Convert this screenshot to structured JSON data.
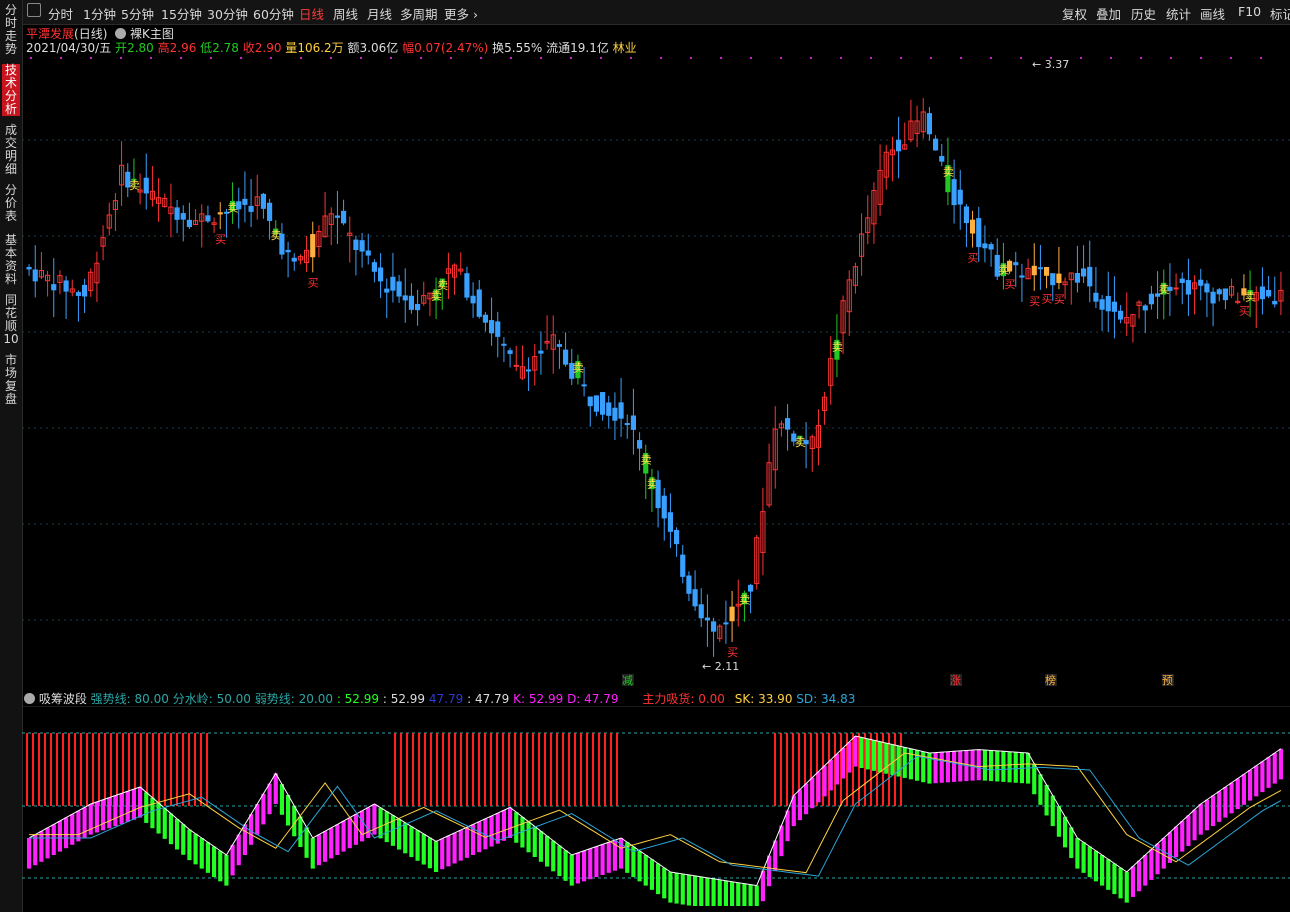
{
  "toolbar": {
    "periods": [
      "分时",
      "1分钟",
      "5分钟",
      "15分钟",
      "30分钟",
      "60分钟",
      "日线",
      "周线",
      "月线",
      "多周期",
      "更多"
    ],
    "active": "日线",
    "right": [
      "复权",
      "叠加",
      "历史",
      "统计",
      "画线",
      "F10",
      "标记"
    ]
  },
  "sidebar": [
    "分时走势",
    "技术分析",
    "成交明细",
    "分价表",
    "基本资料",
    "同花顺10",
    "市场复盘"
  ],
  "stock": {
    "name": "平潭发展",
    "period": "(日线)",
    "main_chart": "裸K主图",
    "date": "2021/04/30/五",
    "open_label": "开",
    "open": "2.80",
    "high_label": "高",
    "high": "2.96",
    "low_label": "低",
    "low": "2.78",
    "close_label": "收",
    "close": "2.90",
    "volume_label": "量",
    "volume": "106.2万",
    "amount_label": "额",
    "amount": "3.06亿",
    "change_label": "幅",
    "change": "0.07(2.47%)",
    "turnover_label": "换",
    "turnover": "5.55%",
    "float_label": "流通",
    "float": "19.1亿",
    "industry": "林业"
  },
  "main_chart": {
    "max_label": "3.37",
    "min_label": "2.11",
    "buy_label": "买",
    "sell_label": "卖",
    "events": [
      "减",
      "涨",
      "榜",
      "预"
    ]
  },
  "indicator": {
    "name": "吸筹波段",
    "strong": "强势线: 80.00",
    "water": "分水岭: 50.00",
    "weak": "弱势线: 20.00",
    "v1": ": 52.99",
    "v2": ": 52.99",
    "v3": "47.79",
    "v4": ": 47.79",
    "k": "K: 52.99",
    "d": "D: 47.79",
    "main_force": "主力吸货: 0.00",
    "sk": "SK: 33.90",
    "sd": "SD: 34.83"
  },
  "colors": {
    "up": "#ff3232",
    "down": "#3aa0ff",
    "sell_bar": "#22c822",
    "buy_bar": "#ffb040",
    "cyan_bar": "#5ee8f0",
    "magenta": "#ff22ff",
    "green_hist": "#22ff22"
  }
}
